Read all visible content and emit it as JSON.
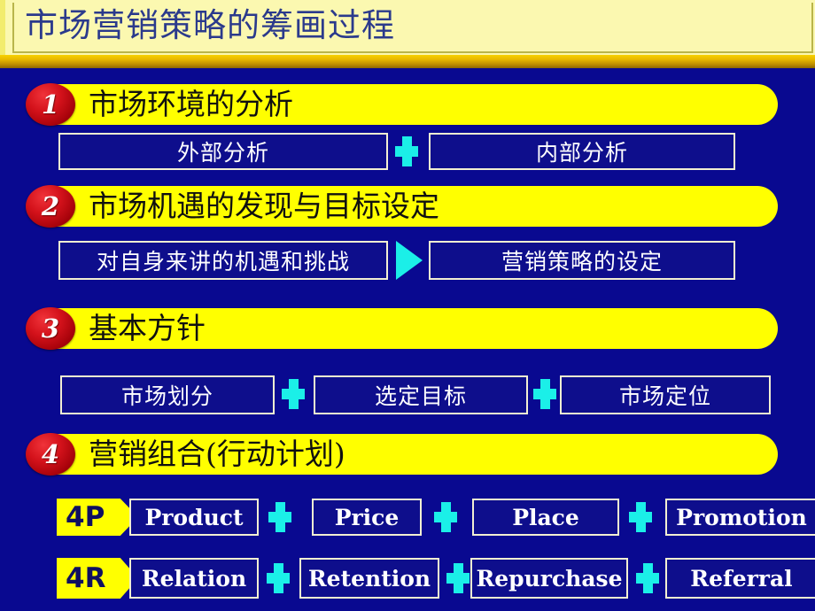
{
  "slide": {
    "title": "市场营销策略的筹画过程",
    "background_color": "#090990",
    "title_band_color": "#FBF8B0",
    "title_text_color": "#2B3A8C",
    "accent_yellow": "#FFFF00",
    "accent_cyan": "#1BEFE8",
    "badge_red": "#D4121B"
  },
  "sections": [
    {
      "number": "1",
      "heading": "市场环境的分析",
      "connector": "plus-icon",
      "items": [
        {
          "label": "外部分析"
        },
        {
          "label": "内部分析"
        }
      ]
    },
    {
      "number": "2",
      "heading": "市场机遇的发现与目标设定",
      "connector": "triangle-arrow-icon",
      "items": [
        {
          "label": "对自身来讲的机遇和挑战"
        },
        {
          "label": "营销策略的设定"
        }
      ]
    },
    {
      "number": "3",
      "heading": "基本方针",
      "connector": "plus-icon",
      "items": [
        {
          "label": "市场划分"
        },
        {
          "label": "选定目标"
        },
        {
          "label": "市场定位"
        }
      ]
    },
    {
      "number": "4",
      "heading": "营销组合(行动计划)",
      "connector": "plus-icon",
      "rows": [
        {
          "tag": "4P",
          "items": [
            {
              "label": "Product"
            },
            {
              "label": "Price"
            },
            {
              "label": "Place"
            },
            {
              "label": "Promotion"
            }
          ]
        },
        {
          "tag": "4R",
          "items": [
            {
              "label": "Relation"
            },
            {
              "label": "Retention"
            },
            {
              "label": "Repurchase"
            },
            {
              "label": "Referral"
            }
          ]
        }
      ]
    }
  ]
}
